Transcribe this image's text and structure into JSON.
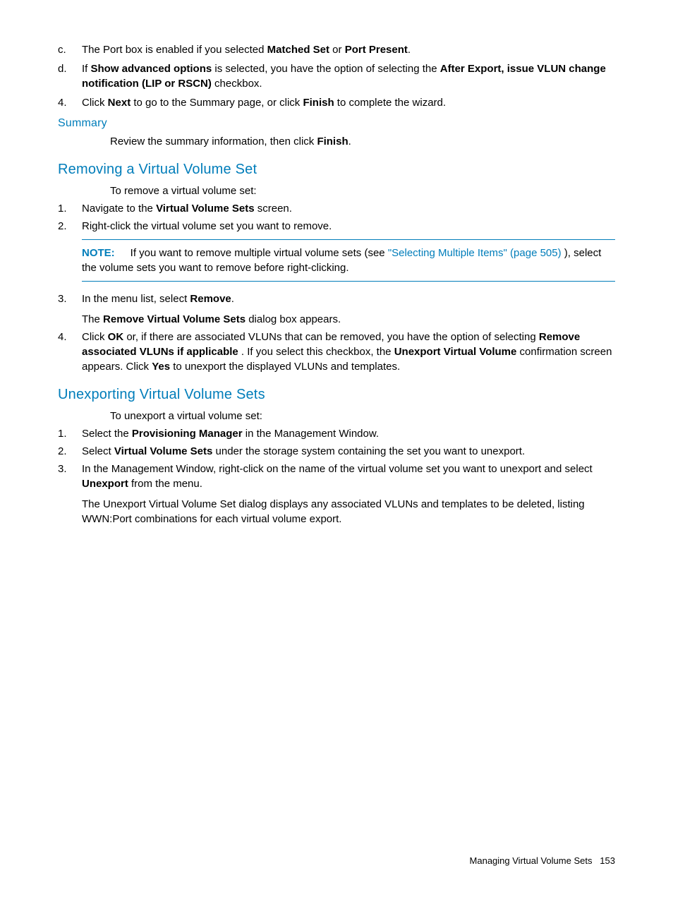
{
  "top_list": {
    "alpha": [
      {
        "marker": "c.",
        "parts": [
          {
            "t": "The Port box is enabled if you selected "
          },
          {
            "t": "Matched Set",
            "b": true
          },
          {
            "t": " or "
          },
          {
            "t": "Port Present",
            "b": true
          },
          {
            "t": "."
          }
        ]
      },
      {
        "marker": "d.",
        "parts": [
          {
            "t": "If "
          },
          {
            "t": "Show advanced options",
            "b": true
          },
          {
            "t": " is selected, you have the option of selecting the "
          },
          {
            "t": "After Export, issue VLUN change notification (LIP or RSCN)",
            "b": true
          },
          {
            "t": " checkbox."
          }
        ]
      }
    ],
    "num4": {
      "marker": "4.",
      "parts": [
        {
          "t": "Click "
        },
        {
          "t": "Next",
          "b": true
        },
        {
          "t": " to go to the Summary page, or click "
        },
        {
          "t": "Finish",
          "b": true
        },
        {
          "t": " to complete the wizard."
        }
      ]
    }
  },
  "summary": {
    "heading": "Summary",
    "text_parts": [
      {
        "t": "Review the summary information, then click "
      },
      {
        "t": "Finish",
        "b": true
      },
      {
        "t": "."
      }
    ]
  },
  "removing": {
    "heading": "Removing a Virtual Volume Set",
    "intro": "To remove a virtual volume set:",
    "items": [
      {
        "marker": "1.",
        "parts": [
          {
            "t": "Navigate to the "
          },
          {
            "t": "Virtual Volume Sets",
            "b": true
          },
          {
            "t": " screen."
          }
        ]
      },
      {
        "marker": "2.",
        "parts": [
          {
            "t": "Right-click the virtual volume set you want to remove."
          }
        ],
        "note": {
          "label": "NOTE:",
          "parts": [
            {
              "t": "If you want to remove multiple virtual volume sets (see "
            },
            {
              "t": "\"Selecting Multiple Items\" (page 505)",
              "link": true
            },
            {
              "t": " ), select the volume sets you want to remove before right-clicking."
            }
          ]
        }
      },
      {
        "marker": "3.",
        "parts": [
          {
            "t": "In the menu list, select "
          },
          {
            "t": "Remove",
            "b": true
          },
          {
            "t": "."
          }
        ],
        "after_parts": [
          {
            "t": "The "
          },
          {
            "t": "Remove Virtual Volume Sets",
            "b": true
          },
          {
            "t": " dialog box appears."
          }
        ]
      },
      {
        "marker": "4.",
        "parts": [
          {
            "t": "Click "
          },
          {
            "t": "OK",
            "b": true
          },
          {
            "t": " or, if there are associated VLUNs that can be removed, you have the option of selecting "
          },
          {
            "t": "Remove associated VLUNs if applicable",
            "b": true
          },
          {
            "t": " . If you select this checkbox, the "
          },
          {
            "t": "Unexport Virtual Volume",
            "b": true
          },
          {
            "t": " confirmation screen appears. Click "
          },
          {
            "t": "Yes",
            "b": true
          },
          {
            "t": " to unexport the displayed VLUNs and templates."
          }
        ]
      }
    ]
  },
  "unexporting": {
    "heading": "Unexporting Virtual Volume Sets",
    "intro": "To unexport a virtual volume set:",
    "items": [
      {
        "marker": "1.",
        "parts": [
          {
            "t": "Select the "
          },
          {
            "t": "Provisioning Manager",
            "b": true
          },
          {
            "t": " in the Management Window."
          }
        ]
      },
      {
        "marker": "2.",
        "parts": [
          {
            "t": "Select "
          },
          {
            "t": "Virtual Volume Sets",
            "b": true
          },
          {
            "t": " under the storage system containing the set you want to unexport."
          }
        ]
      },
      {
        "marker": "3.",
        "parts": [
          {
            "t": "In the Management Window, right-click on the name of the virtual volume set you want to unexport and select "
          },
          {
            "t": "Unexport",
            "b": true
          },
          {
            "t": " from the menu."
          }
        ],
        "after_parts": [
          {
            "t": "The Unexport Virtual Volume Set dialog displays any associated VLUNs and templates to be deleted, listing WWN:Port combinations for each virtual volume export."
          }
        ]
      }
    ]
  },
  "footer": {
    "section": "Managing Virtual Volume Sets",
    "page": "153"
  }
}
